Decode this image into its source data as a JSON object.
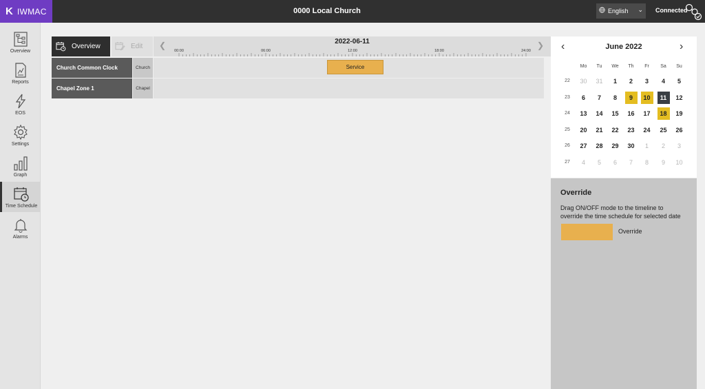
{
  "app": {
    "logo_mark": "K",
    "logo_text": "IWMAC",
    "site_title": "0000 Local Church"
  },
  "language": {
    "selected": "English"
  },
  "connection": {
    "status": "Connected"
  },
  "sidebar": {
    "items": [
      {
        "label": "Overview",
        "icon": "sitemap-icon"
      },
      {
        "label": "Reports",
        "icon": "report-icon"
      },
      {
        "label": "EOS",
        "icon": "lightning-icon"
      },
      {
        "label": "Settings",
        "icon": "gear-icon"
      },
      {
        "label": "Graph",
        "icon": "bar-graph-icon"
      },
      {
        "label": "Time Schedule",
        "icon": "calendar-clock-icon",
        "active": true
      },
      {
        "label": "Alarms",
        "icon": "bell-icon"
      }
    ]
  },
  "tabs": {
    "overview": "Overview",
    "edit": "Edit"
  },
  "timeline": {
    "date": "2022-06-11",
    "hours": [
      "00:00",
      "06:00",
      "12:00",
      "18:00",
      "24:00"
    ]
  },
  "schedule": {
    "rows": [
      {
        "name": "Church Common Clock",
        "zone": "Church",
        "block": {
          "label": "Service",
          "start_hour": 12.0,
          "end_hour": 15.9
        }
      },
      {
        "name": "Chapel Zone 1",
        "zone": "Chapel"
      }
    ]
  },
  "calendar": {
    "month": "June 2022",
    "weekdays": [
      "Mo",
      "Tu",
      "We",
      "Th",
      "Fr",
      "Sa",
      "Su"
    ],
    "weeks": [
      {
        "wk": "22",
        "days": [
          [
            "30",
            1
          ],
          [
            "31",
            1
          ],
          [
            "1",
            0
          ],
          [
            "2",
            0
          ],
          [
            "3",
            0
          ],
          [
            "4",
            0
          ],
          [
            "5",
            0
          ]
        ]
      },
      {
        "wk": "23",
        "days": [
          [
            "6",
            0
          ],
          [
            "7",
            0
          ],
          [
            "8",
            0
          ],
          [
            "9",
            2
          ],
          [
            "10",
            2
          ],
          [
            "11",
            3
          ],
          [
            "12",
            0
          ]
        ]
      },
      {
        "wk": "24",
        "days": [
          [
            "13",
            0
          ],
          [
            "14",
            0
          ],
          [
            "15",
            0
          ],
          [
            "16",
            0
          ],
          [
            "17",
            0
          ],
          [
            "18",
            2
          ],
          [
            "19",
            0
          ]
        ]
      },
      {
        "wk": "25",
        "days": [
          [
            "20",
            0
          ],
          [
            "21",
            0
          ],
          [
            "22",
            0
          ],
          [
            "23",
            0
          ],
          [
            "24",
            0
          ],
          [
            "25",
            0
          ],
          [
            "26",
            0
          ]
        ]
      },
      {
        "wk": "26",
        "days": [
          [
            "27",
            0
          ],
          [
            "28",
            0
          ],
          [
            "29",
            0
          ],
          [
            "30",
            0
          ],
          [
            "1",
            1
          ],
          [
            "2",
            1
          ],
          [
            "3",
            1
          ]
        ]
      },
      {
        "wk": "27",
        "days": [
          [
            "4",
            1
          ],
          [
            "5",
            1
          ],
          [
            "6",
            1
          ],
          [
            "7",
            1
          ],
          [
            "8",
            1
          ],
          [
            "9",
            1
          ],
          [
            "10",
            1
          ]
        ]
      }
    ],
    "highlight_color": "#e4bd21",
    "selected_color": "#3a3f44"
  },
  "override": {
    "title": "Override",
    "description": "Drag ON/OFF mode to the timeline to override the time schedule for selected date",
    "swatch_label": "Override",
    "swatch_color": "#e8b04e"
  }
}
